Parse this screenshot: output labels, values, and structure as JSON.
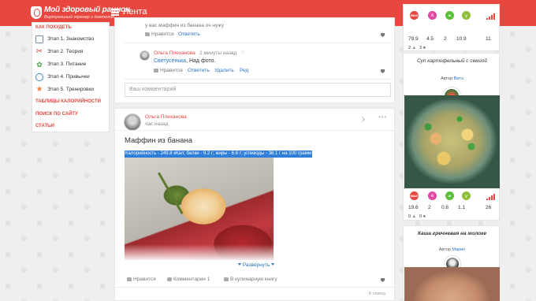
{
  "header": {
    "logo_title": "Мой здоровый рацион",
    "logo_subtitle": "Виртуальный тренер и диетолог",
    "page_title": "Лента"
  },
  "sidebar": {
    "lose_weight_heading": "КАК ПОХУДЕТЬ",
    "stages": [
      {
        "label": "Этап 1. Знакомство",
        "icon": "scale-icon"
      },
      {
        "label": "Этап 2. Теория",
        "icon": "tools-icon"
      },
      {
        "label": "Этап 3. Питание",
        "icon": "apple-icon"
      },
      {
        "label": "Этап 4. Привычки",
        "icon": "clock-icon"
      },
      {
        "label": "Этап 5. Тренировки",
        "icon": "runner-icon"
      }
    ],
    "calorie_tables": "ТАБЛИЦЫ КАЛОРИЙНОСТИ",
    "site_search": "ПОИСК ПО САЙТУ",
    "articles": "СТАТЬИ"
  },
  "comment_card": {
    "partial_text": "у вас маффин из банана оч нужу",
    "actions1": {
      "like": "Нравится",
      "reply": "Ответить"
    },
    "reply": {
      "author": "Ольга Плеханова",
      "time": "2 минуты назад",
      "mention": "Светусенька",
      "text": ", Над фото."
    },
    "actions2": {
      "like": "Нравится",
      "reply": "Ответить",
      "delete": "Удалить",
      "edit": "Ред"
    },
    "input_placeholder": "Ваш комментарий"
  },
  "post": {
    "author": "Ольга Плеханова",
    "time": "час назад",
    "title": "Маффин из банана",
    "nutrition": "Калорийность - 249.8 кКал; белки - 9.2 г; жиры - 6.6 г; углеводы - 38.1 г на 100 грамм",
    "expand": "Развернуть",
    "like": "Нравится",
    "comments": "Комментарии 1",
    "cookbook": "В кулинарную книгу",
    "to_list": "К списку"
  },
  "right_cards": [
    {
      "badges": [
        {
          "code": "ккал",
          "color": "#e8473f",
          "value": "79.9"
        },
        {
          "code": "б",
          "color": "#e04aa5",
          "value": "4.5"
        },
        {
          "code": "ж",
          "color": "#5bbf3a",
          "value": "2"
        },
        {
          "code": "у",
          "color": "#8fbf3a",
          "value": "10.9"
        }
      ],
      "score": "11",
      "stats": {
        "likes": "2",
        "comments": "3"
      }
    },
    {
      "title": "Суп картофельный с семгой",
      "author_label": "Автор",
      "author": "Вита",
      "badges": [
        {
          "code": "ккал",
          "color": "#e8473f",
          "value": "19.6"
        },
        {
          "code": "б",
          "color": "#e04aa5",
          "value": "2"
        },
        {
          "code": "ж",
          "color": "#5bbf3a",
          "value": "0.8"
        },
        {
          "code": "у",
          "color": "#8fbf3a",
          "value": "1.1"
        }
      ],
      "score": "26",
      "stats": {
        "likes": "0",
        "comments": "0"
      }
    },
    {
      "title": "Каша гречневая на молоке",
      "author_label": "Автор",
      "author": "Марин"
    }
  ]
}
